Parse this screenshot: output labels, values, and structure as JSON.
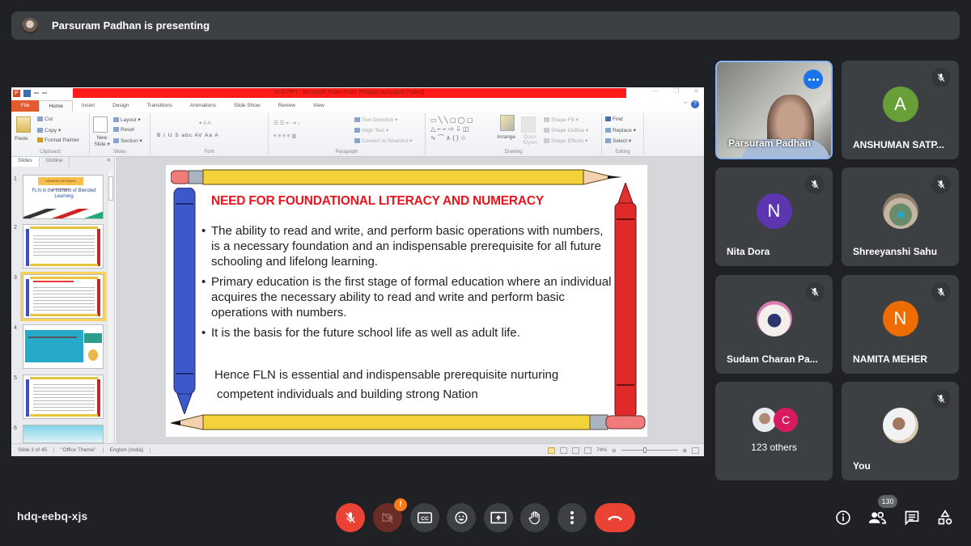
{
  "banner": {
    "text": "Parsuram Padhan is presenting"
  },
  "powerpoint": {
    "title_bar_text": "FLN PPT - Microsoft PowerPoint (Product Activation Failed)",
    "window_buttons": [
      "—",
      "❐",
      "✕"
    ],
    "tabs": [
      "File",
      "Home",
      "Insert",
      "Design",
      "Transitions",
      "Animations",
      "Slide Show",
      "Review",
      "View"
    ],
    "active_tab": "Home",
    "ribbon": {
      "clipboard": {
        "label": "Clipboard",
        "paste": "Paste",
        "cut": "Cut",
        "copy": "Copy ▾",
        "format_painter": "Format Painter"
      },
      "slides": {
        "label": "Slides",
        "new_slide": "New Slide ▾",
        "layout": "Layout ▾",
        "reset": "Reset",
        "section": "Section ▾"
      },
      "font": {
        "label": "Font",
        "buttons": "B  I  U  S  abc  AV  Aa  A"
      },
      "paragraph": {
        "label": "Paragraph",
        "text_direction": "Text Direction ▾",
        "align_text": "Align Text ▾",
        "convert_smartart": "Convert to SmartArt ▾"
      },
      "drawing": {
        "label": "Drawing",
        "arrange": "Arrange",
        "quick_styles": "Quick Styles",
        "shape_fill": "Shape Fill ▾",
        "shape_outline": "Shape Outline ▾",
        "shape_effects": "Shape Effects ▾"
      },
      "editing": {
        "label": "Editing",
        "find": "Find",
        "replace": "Replace ▾",
        "select": "Select ▾"
      }
    },
    "panel_tabs": [
      "Slides",
      "Outline"
    ],
    "thumbnails": [
      {
        "num": "1",
        "title": "FLN in the context of Blended Learning",
        "header": "KENDRIYA VIDYALAYA SANGATHAN"
      },
      {
        "num": "2"
      },
      {
        "num": "3",
        "selected": true
      },
      {
        "num": "4"
      },
      {
        "num": "5"
      },
      {
        "num": "6"
      }
    ],
    "slide": {
      "title": "NEED FOR FOUNDATIONAL  LITERACY AND NUMERACY",
      "bullets": [
        "The ability to read and write, and perform basic operations with numbers, is a necessary foundation and an indispensable prerequisite for all future schooling and lifelong learning.",
        " Primary education is the first stage of formal education where an individual acquires the necessary ability to read and write and perform basic operations with numbers.",
        "It is the basis for the future school life as well as adult life."
      ],
      "conclusion": [
        "Hence FLN is essential and indispensable prerequisite nurturing",
        "competent individuals and building strong Nation"
      ]
    },
    "status": {
      "slide_info": "Slide 3 of 45",
      "theme": "\"Office Theme\"",
      "language": "English (India)",
      "zoom": "74%",
      "zoom_fraction": 0.42
    }
  },
  "participants": [
    {
      "name": "Parsuram Padhan",
      "type": "video",
      "presenter": true
    },
    {
      "name": "ANSHUMAN SATP...",
      "initial": "A",
      "color": "#689f38",
      "muted": true
    },
    {
      "name": "Nita Dora",
      "initial": "N",
      "color": "#5e35b1",
      "muted": true
    },
    {
      "name": "Shreeyanshi Sahu",
      "type": "photo",
      "muted": true
    },
    {
      "name": "Sudam Charan Pa...",
      "type": "photo",
      "muted": true
    },
    {
      "name": "NAMITA MEHER",
      "initial": "N",
      "color": "#ef6c00",
      "muted": true
    },
    {
      "others_label": "123 others",
      "initial": "C",
      "color": "#d81b60"
    },
    {
      "name": "You",
      "type": "photo",
      "muted": true
    }
  ],
  "bottom": {
    "meeting_code": "hdq-eebq-xjs",
    "camera_badge": "!",
    "people_count": "130"
  }
}
